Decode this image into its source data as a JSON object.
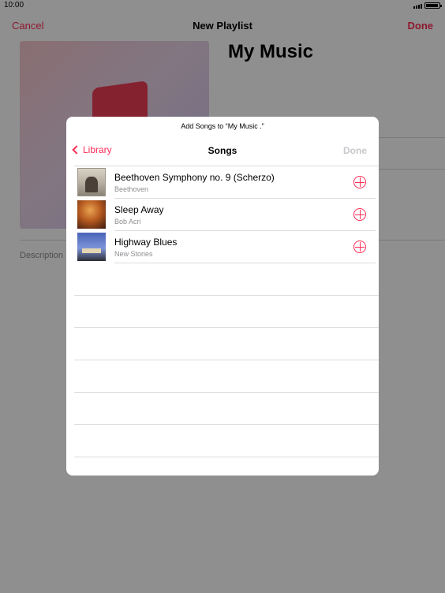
{
  "status_bar": {
    "time": "10:00"
  },
  "background": {
    "nav": {
      "cancel_label": "Cancel",
      "title": "New Playlist",
      "done_label": "Done"
    },
    "playlist_title": "My Music",
    "description_placeholder": "Description"
  },
  "modal": {
    "prompt": "Add Songs to “My Music .”",
    "back_label": "Library",
    "title": "Songs",
    "done_label": "Done",
    "songs": [
      {
        "title": "Beethoven Symphony no. 9 (Scherzo)",
        "artist": "Beethoven"
      },
      {
        "title": "Sleep Away",
        "artist": "Bob Acri"
      },
      {
        "title": "Highway Blues",
        "artist": "New Stories"
      }
    ]
  },
  "colors": {
    "accent": "#ff2d55",
    "disabled": "#c8c8cc",
    "secondary_text": "#8e8e93"
  }
}
